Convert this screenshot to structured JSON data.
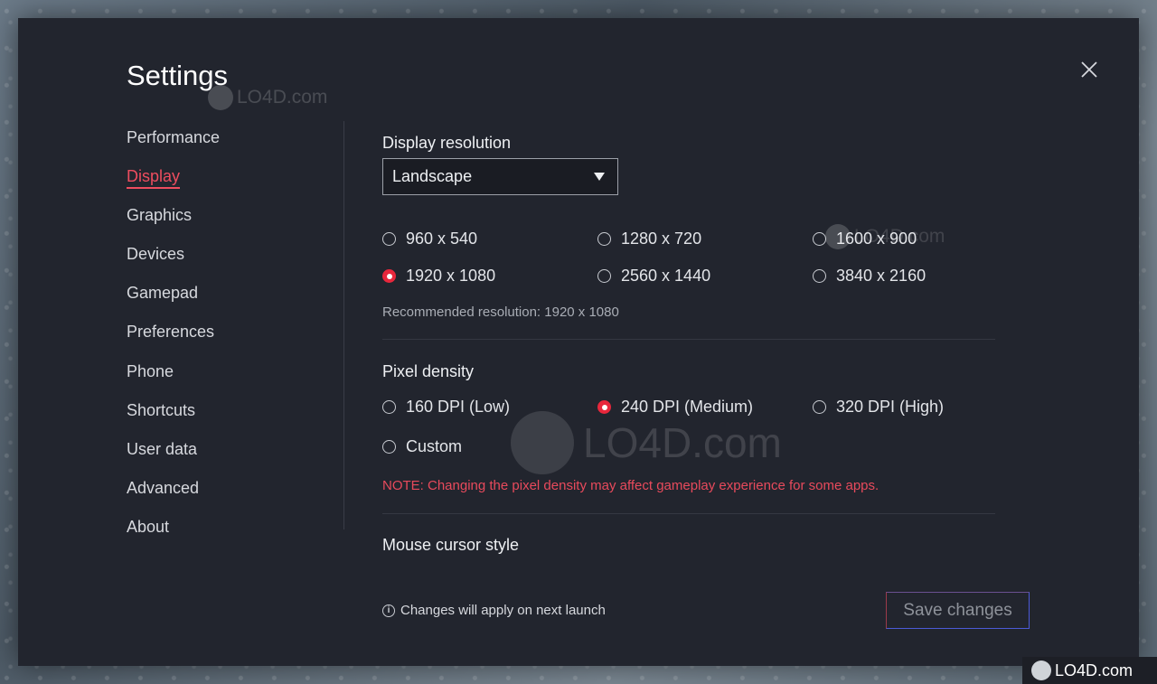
{
  "dialog": {
    "title": "Settings"
  },
  "watermark": {
    "text": "LO4D.com"
  },
  "sidebar": {
    "items": [
      {
        "label": "Performance",
        "active": false
      },
      {
        "label": "Display",
        "active": true
      },
      {
        "label": "Graphics",
        "active": false
      },
      {
        "label": "Devices",
        "active": false
      },
      {
        "label": "Gamepad",
        "active": false
      },
      {
        "label": "Preferences",
        "active": false
      },
      {
        "label": "Phone",
        "active": false
      },
      {
        "label": "Shortcuts",
        "active": false
      },
      {
        "label": "User data",
        "active": false
      },
      {
        "label": "Advanced",
        "active": false
      },
      {
        "label": "About",
        "active": false
      }
    ]
  },
  "display_resolution": {
    "title": "Display resolution",
    "orientation_value": "Landscape",
    "options": [
      {
        "label": "960 x 540",
        "checked": false
      },
      {
        "label": "1280 x 720",
        "checked": false
      },
      {
        "label": "1600 x 900",
        "checked": false
      },
      {
        "label": "1920 x 1080",
        "checked": true
      },
      {
        "label": "2560 x 1440",
        "checked": false
      },
      {
        "label": "3840 x 2160",
        "checked": false
      }
    ],
    "recommended": "Recommended resolution: 1920 x 1080"
  },
  "pixel_density": {
    "title": "Pixel density",
    "options": [
      {
        "label": "160 DPI (Low)",
        "checked": false
      },
      {
        "label": "240 DPI (Medium)",
        "checked": true
      },
      {
        "label": "320 DPI (High)",
        "checked": false
      },
      {
        "label": "Custom",
        "checked": false
      }
    ],
    "note": "NOTE: Changing the pixel density may affect gameplay experience for some apps."
  },
  "mouse_cursor": {
    "title": "Mouse cursor style"
  },
  "footer": {
    "info": "Changes will apply on next launch",
    "save_label": "Save changes"
  },
  "colors": {
    "accent": "#e8273c",
    "dialog_bg": "#22252e"
  }
}
